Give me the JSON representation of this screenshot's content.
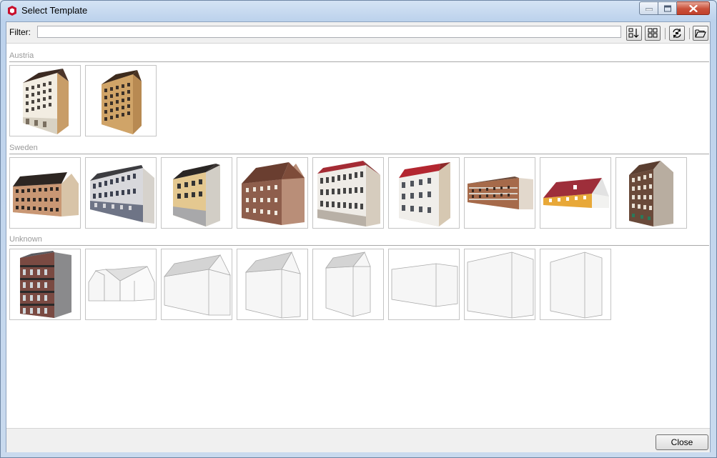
{
  "window": {
    "title": "Select Template"
  },
  "filter": {
    "label": "Filter:",
    "value": ""
  },
  "groups": [
    {
      "name": "Austria",
      "templates": [
        "austria-building-1",
        "austria-building-2"
      ]
    },
    {
      "name": "Sweden",
      "templates": [
        "sweden-building-1",
        "sweden-building-2",
        "sweden-building-3",
        "sweden-building-4",
        "sweden-building-5",
        "sweden-building-6",
        "sweden-building-7",
        "sweden-building-8",
        "sweden-building-9"
      ]
    },
    {
      "name": "Unknown",
      "templates": [
        "unknown-building-1",
        "unknown-building-2",
        "unknown-building-3",
        "unknown-building-4",
        "unknown-building-5",
        "unknown-building-6",
        "unknown-building-7",
        "unknown-building-8"
      ]
    }
  ],
  "buttons": {
    "close": "Close"
  },
  "toolbar_icons": [
    "sort-icon",
    "grid-view-icon",
    "refresh-icon",
    "open-folder-icon"
  ]
}
